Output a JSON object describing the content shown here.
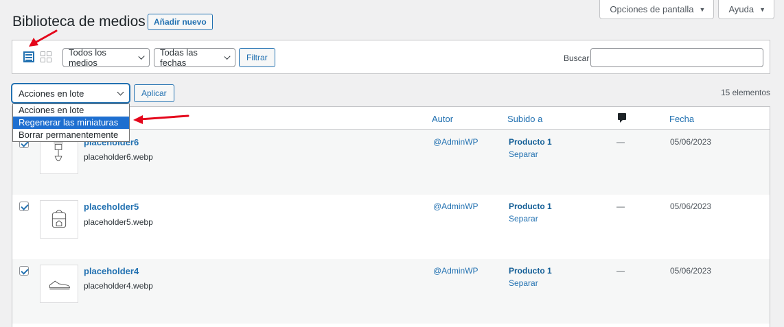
{
  "header": {
    "title": "Biblioteca de medios",
    "add_new": "Añadir nuevo",
    "screen_options": "Opciones de pantalla",
    "help": "Ayuda"
  },
  "filters": {
    "media_type": "Todos los medios",
    "dates": "Todas las fechas",
    "filter_button": "Filtrar",
    "search_label": "Buscar",
    "search_value": ""
  },
  "bulk": {
    "selected": "Acciones en lote",
    "apply": "Aplicar",
    "count": "15 elementos",
    "options": [
      "Acciones en lote",
      "Regenerar las miniaturas",
      "Borrar permanentemente"
    ],
    "highlighted_index": 1
  },
  "table": {
    "columns": {
      "author": "Autor",
      "attached": "Subido a",
      "comments_icon": "comment-icon",
      "date": "Fecha"
    },
    "rows": [
      {
        "title": "placeholder6",
        "filename": "placeholder6.webp",
        "author": "@AdminWP",
        "attached_to": "Producto 1",
        "detach": "Separar",
        "comments": "—",
        "date": "05/06/2023",
        "checked": true,
        "icon": "lamp-icon"
      },
      {
        "title": "placeholder5",
        "filename": "placeholder5.webp",
        "author": "@AdminWP",
        "attached_to": "Producto 1",
        "detach": "Separar",
        "comments": "—",
        "date": "05/06/2023",
        "checked": true,
        "icon": "backpack-icon"
      },
      {
        "title": "placeholder4",
        "filename": "placeholder4.webp",
        "author": "@AdminWP",
        "attached_to": "Producto 1",
        "detach": "Separar",
        "comments": "—",
        "date": "05/06/2023",
        "checked": true,
        "icon": "sneaker-icon"
      }
    ]
  },
  "colors": {
    "accent": "#2271b1",
    "highlight": "#1e6fd0",
    "annotation_arrow": "#e4061b"
  }
}
